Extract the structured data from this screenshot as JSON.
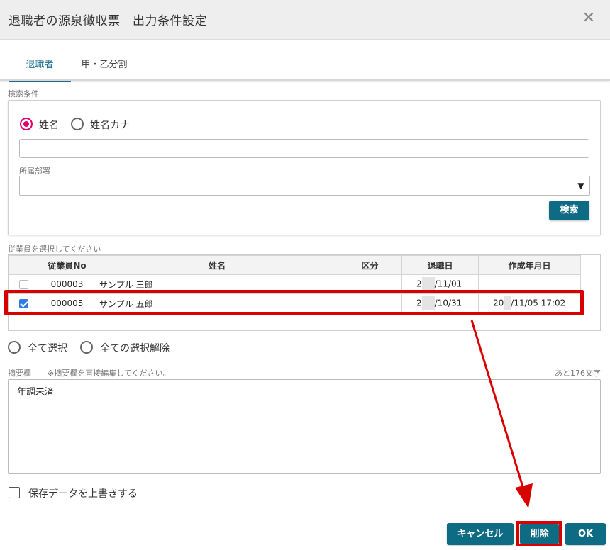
{
  "dialog": {
    "title": "退職者の源泉徴収票　出力条件設定",
    "close_icon": "close-icon"
  },
  "tabs": [
    {
      "label": "退職者",
      "active": true
    },
    {
      "label": "甲・乙分割",
      "active": false
    }
  ],
  "search": {
    "section_label": "検索条件",
    "radio_options": [
      {
        "label": "姓名",
        "checked": true
      },
      {
        "label": "姓名カナ",
        "checked": false
      }
    ],
    "name_value": "",
    "department_label": "所属部署",
    "department_value": "",
    "search_button": "検索"
  },
  "employees": {
    "section_label": "従業員を選択してください",
    "columns": [
      "",
      "従業員No",
      "姓名",
      "区分",
      "退職日",
      "作成年月日"
    ],
    "rows": [
      {
        "checked": false,
        "no": "000003",
        "name": "サンプル 三郎",
        "kubun": "",
        "retire_prefix": "2",
        "retire_suffix": "/11/01",
        "created_prefix": "",
        "created_suffix": ""
      },
      {
        "checked": true,
        "no": "000005",
        "name": "サンプル 五郎",
        "kubun": "",
        "retire_prefix": "2",
        "retire_suffix": "/10/31",
        "created_prefix": "20",
        "created_suffix": "/11/05 17:02"
      }
    ]
  },
  "selection": {
    "select_all": "全て選択",
    "deselect_all": "全ての選択解除"
  },
  "memo": {
    "label": "摘要欄",
    "note": "※摘要欄を直接編集してください。",
    "remaining": "あと176文字",
    "value": "年調未済"
  },
  "overwrite_label": "保存データを上書きする",
  "footer": {
    "cancel": "キャンセル",
    "delete": "削除",
    "ok": "OK"
  },
  "colors": {
    "accent": "#0d6b83",
    "radio_selected": "#e3006b",
    "annotation": "#d90000",
    "checkbox_checked": "#2f7de1"
  }
}
